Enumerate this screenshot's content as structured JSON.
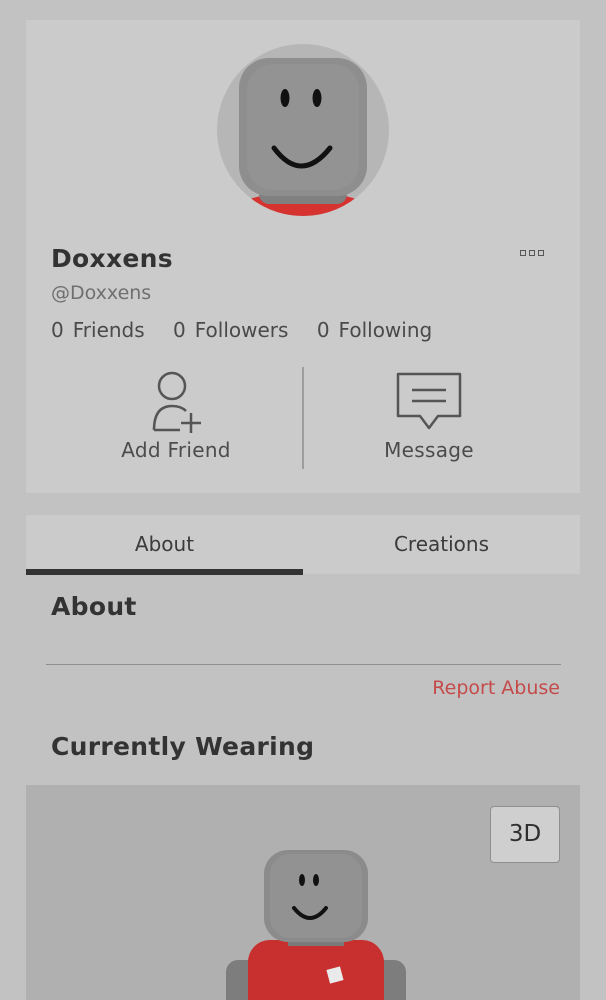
{
  "profile": {
    "display_name": "Doxxens",
    "username": "@Doxxens",
    "stats": [
      {
        "count": "0",
        "label": "Friends"
      },
      {
        "count": "0",
        "label": "Followers"
      },
      {
        "count": "0",
        "label": "Following"
      }
    ],
    "actions": {
      "add_friend": "Add Friend",
      "message": "Message"
    },
    "icons": {
      "more": "more-options-icon",
      "add_friend": "add-friend-icon",
      "message": "message-icon"
    }
  },
  "tabs": [
    {
      "label": "About",
      "active": true
    },
    {
      "label": "Creations",
      "active": false
    }
  ],
  "about": {
    "heading": "About",
    "report_abuse": "Report Abuse"
  },
  "wearing": {
    "heading": "Currently Wearing",
    "three_d_label": "3D"
  },
  "colors": {
    "report_abuse": "#c54a4a",
    "shirt": "#c7302e",
    "head": "#8a8a8a"
  }
}
